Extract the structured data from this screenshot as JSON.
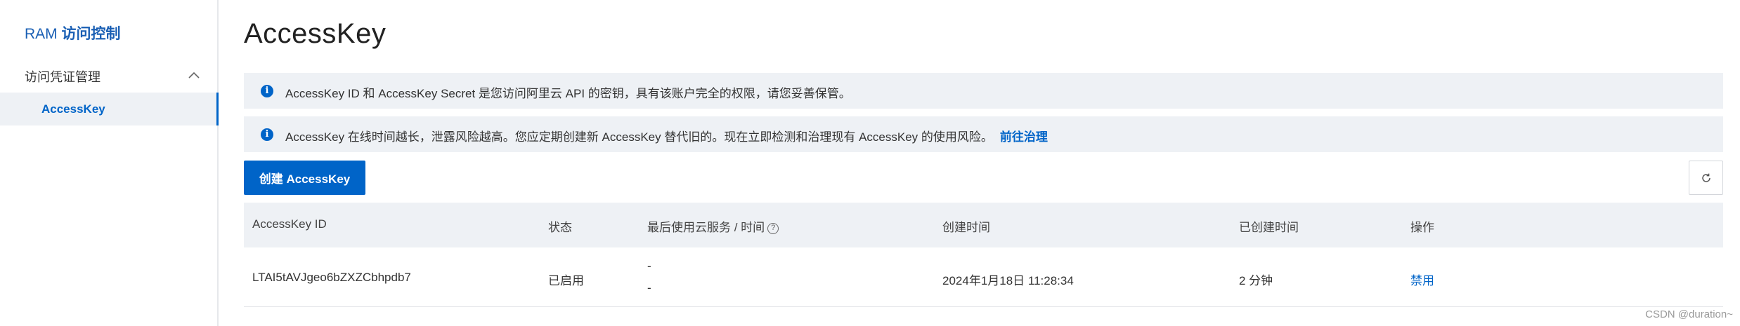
{
  "sidebar": {
    "brand_prefix": "RAM",
    "brand_name": "访问控制",
    "group_label": "访问凭证管理",
    "active_item": "AccessKey"
  },
  "main": {
    "title": "AccessKey",
    "notice1": "AccessKey ID 和 AccessKey Secret 是您访问阿里云 API 的密钥，具有该账户完全的权限，请您妥善保管。",
    "notice2": "AccessKey 在线时间越长，泄露风险越高。您应定期创建新 AccessKey 替代旧的。现在立即检测和治理现有 AccessKey 的使用风险。",
    "notice2_link": "前往治理",
    "create_button": "创建 AccessKey"
  },
  "table": {
    "headers": [
      "AccessKey ID",
      "状态",
      "最后使用云服务 / 时间",
      "创建时间",
      "已创建时间",
      "操作"
    ],
    "rows": [
      {
        "id": "LTAI5tAVJgeo6bZXZCbhpdb7",
        "status": "已启用",
        "last_service": "-",
        "last_time": "-",
        "created": "2024年1月18日 11:28:34",
        "age": "2 分钟",
        "action": "禁用"
      }
    ]
  },
  "watermark": "CSDN @duration~",
  "colors": {
    "accent": "#0064c8",
    "notice_bg": "#eef1f5"
  },
  "icons": [
    "chevron-up-icon",
    "info-icon",
    "refresh-icon",
    "help-icon"
  ]
}
